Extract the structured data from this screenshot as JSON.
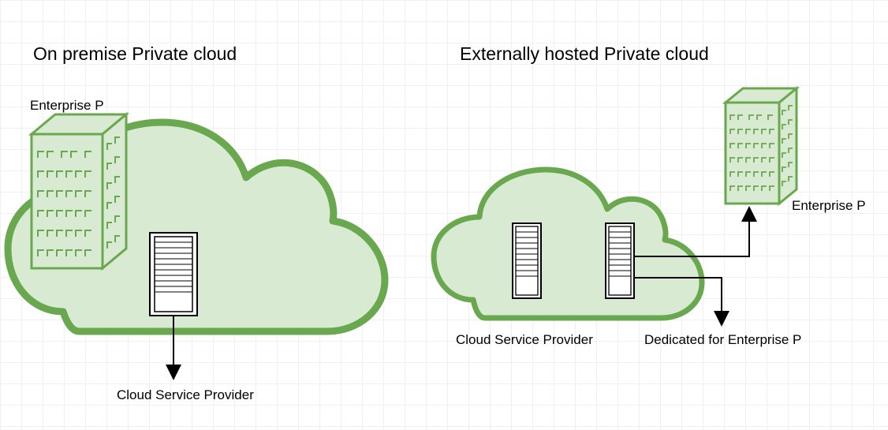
{
  "left": {
    "title": "On premise Private cloud",
    "enterprise_label": "Enterprise P",
    "provider_label": "Cloud Service Provider"
  },
  "right": {
    "title": "Externally hosted Private cloud",
    "enterprise_label": "Enterprise P",
    "provider_label": "Cloud Service Provider",
    "dedicated_label": "Dedicated for Enterprise P"
  },
  "colors": {
    "cloud_stroke": "#6aa84f",
    "cloud_fill": "#d9ead3",
    "building_stroke": "#6aa84f",
    "building_fill": "#d9ead3",
    "arrow": "#000000"
  }
}
